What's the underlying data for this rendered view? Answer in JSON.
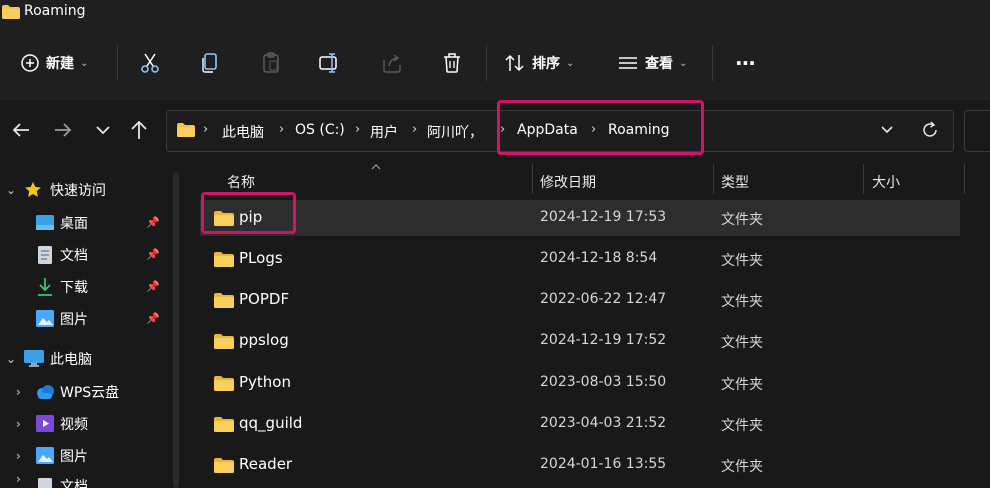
{
  "window": {
    "title": "Roaming"
  },
  "toolbar": {
    "new_label": "新建",
    "sort_label": "排序",
    "view_label": "查看",
    "more_label": "···"
  },
  "address": {
    "crumbs": [
      "此电脑",
      "OS (C:)",
      "用户",
      "阿川吖，",
      "AppData",
      "Roaming"
    ]
  },
  "sidebar": {
    "quick_access": "快速访问",
    "items": [
      {
        "label": "桌面",
        "pinned": true
      },
      {
        "label": "文档",
        "pinned": true
      },
      {
        "label": "下载",
        "pinned": true
      },
      {
        "label": "图片",
        "pinned": true
      }
    ],
    "this_pc": "此电脑",
    "pc_items": [
      {
        "label": "WPS云盘"
      },
      {
        "label": "视频"
      },
      {
        "label": "图片"
      },
      {
        "label": "文档"
      }
    ]
  },
  "list": {
    "columns": {
      "name": "名称",
      "modified": "修改日期",
      "type": "类型",
      "size": "大小"
    },
    "rows": [
      {
        "name": "pip",
        "modified": "2024-12-19 17:53",
        "type": "文件夹",
        "selected": true
      },
      {
        "name": "PLogs",
        "modified": "2024-12-18 8:54",
        "type": "文件夹"
      },
      {
        "name": "POPDF",
        "modified": "2022-06-22 12:47",
        "type": "文件夹"
      },
      {
        "name": "ppslog",
        "modified": "2024-12-19 17:52",
        "type": "文件夹"
      },
      {
        "name": "Python",
        "modified": "2023-08-03 15:50",
        "type": "文件夹"
      },
      {
        "name": "qq_guild",
        "modified": "2023-04-03 21:52",
        "type": "文件夹"
      },
      {
        "name": "Reader",
        "modified": "2024-01-16 13:55",
        "type": "文件夹"
      }
    ]
  },
  "colors": {
    "highlight": "#d0146a",
    "folder": "#f2c14e",
    "accent": "#4aa8ff"
  }
}
